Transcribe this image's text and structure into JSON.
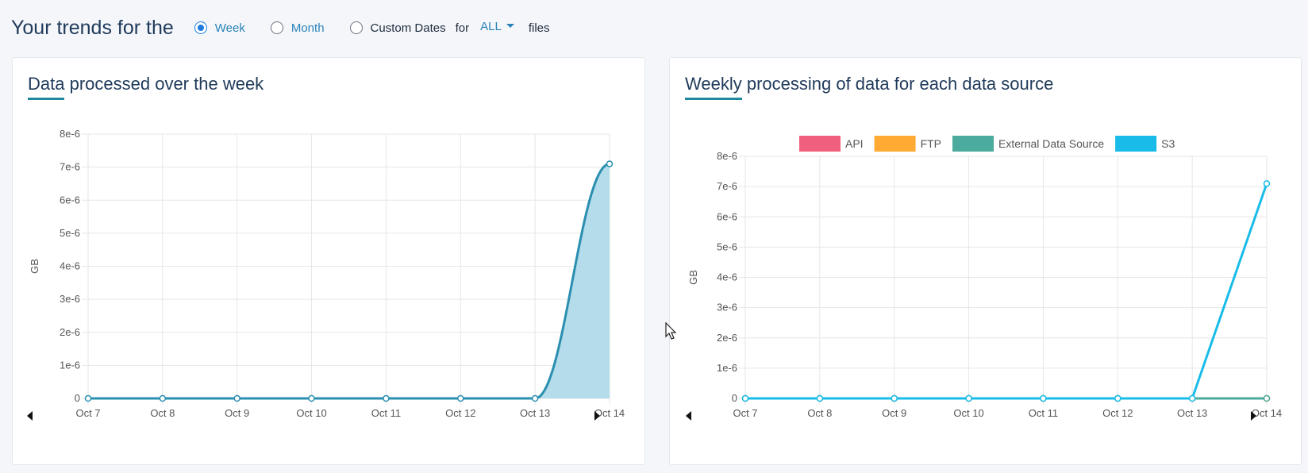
{
  "header": {
    "title": "Your trends for the",
    "options": [
      {
        "label": "Week",
        "checked": true
      },
      {
        "label": "Month",
        "checked": false
      },
      {
        "label": "Custom Dates",
        "checked": false
      }
    ],
    "for_label": "for",
    "files_filter": "ALL",
    "files_label": "files"
  },
  "cards": {
    "left": {
      "title_first": "Data",
      "title_rest": " processed over the week"
    },
    "right": {
      "title_first": "Weekly",
      "title_rest": " processing of data for each data source"
    }
  },
  "chart_data": [
    {
      "type": "area",
      "title": "Data processed over the week",
      "x": [
        "Oct 7",
        "Oct 8",
        "Oct 9",
        "Oct 10",
        "Oct 11",
        "Oct 12",
        "Oct 13",
        "Oct 14"
      ],
      "ylabel": "GB",
      "ylim": [
        0,
        8e-06
      ],
      "yticks": [
        "0",
        "1e-6",
        "2e-6",
        "3e-6",
        "4e-6",
        "5e-6",
        "6e-6",
        "7e-6",
        "8e-6"
      ],
      "grid": true,
      "series": [
        {
          "values": [
            0,
            0,
            0,
            0,
            0,
            0,
            0,
            7.1e-06
          ],
          "color": "#2a8fb0",
          "fill": "#add8e8"
        }
      ]
    },
    {
      "type": "line",
      "title": "Weekly processing of data for each data source",
      "x": [
        "Oct 7",
        "Oct 8",
        "Oct 9",
        "Oct 10",
        "Oct 11",
        "Oct 12",
        "Oct 13",
        "Oct 14"
      ],
      "ylabel": "GB",
      "ylim": [
        0,
        8e-06
      ],
      "yticks": [
        "0",
        "1e-6",
        "2e-6",
        "3e-6",
        "4e-6",
        "5e-6",
        "6e-6",
        "7e-6",
        "8e-6"
      ],
      "grid": true,
      "legend": "top",
      "series": [
        {
          "name": "API",
          "values": [
            0,
            0,
            0,
            0,
            0,
            0,
            0,
            0
          ],
          "color": "#f0607e"
        },
        {
          "name": "FTP",
          "values": [
            0,
            0,
            0,
            0,
            0,
            0,
            0,
            0
          ],
          "color": "#ffab33"
        },
        {
          "name": "External Data Source",
          "values": [
            0,
            0,
            0,
            0,
            0,
            0,
            0,
            0
          ],
          "color": "#4bab9e"
        },
        {
          "name": "S3",
          "values": [
            0,
            0,
            0,
            0,
            0,
            0,
            0,
            7.1e-06
          ],
          "color": "#19bce8"
        }
      ]
    }
  ]
}
